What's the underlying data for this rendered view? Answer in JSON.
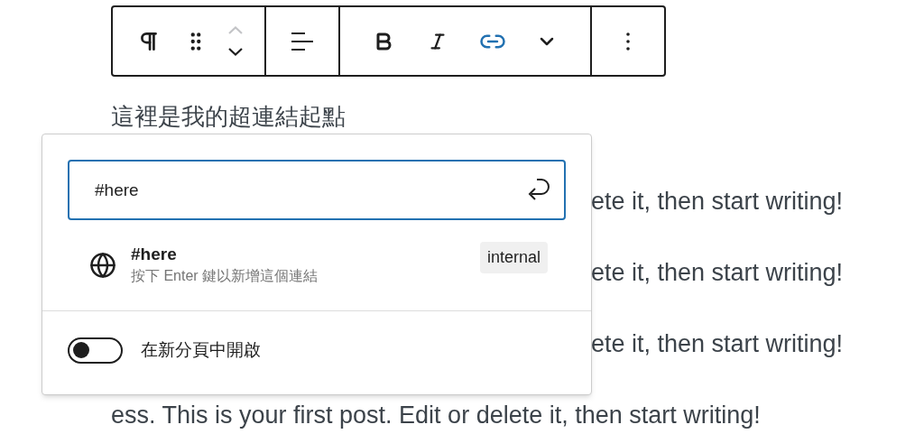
{
  "toolbar": {
    "groups": [
      {
        "buttons": [
          {
            "kind": "paragraph",
            "active": false,
            "disabled": false
          },
          {
            "kind": "drag",
            "active": false,
            "disabled": false
          },
          {
            "kind": "move",
            "up_disabled": true,
            "down_disabled": false
          }
        ]
      },
      {
        "buttons": [
          {
            "kind": "align",
            "active": false,
            "disabled": false
          }
        ]
      },
      {
        "buttons": [
          {
            "kind": "bold",
            "active": false,
            "disabled": false
          },
          {
            "kind": "italic",
            "active": false,
            "disabled": false
          },
          {
            "kind": "link",
            "active": true,
            "disabled": false
          },
          {
            "kind": "more",
            "active": false,
            "disabled": false
          }
        ]
      },
      {
        "buttons": [
          {
            "kind": "options",
            "active": false,
            "disabled": false
          }
        ]
      }
    ]
  },
  "heading_paragraph": "這裡是我的超連結起點",
  "body_lines": [
    {
      "text": "ete it, then start writing!",
      "covered": true
    },
    {
      "text": "ete it, then start writing!",
      "covered": true
    },
    {
      "text": "ete it, then start writing!",
      "covered": true
    },
    {
      "text": "ess. This is your first post. Edit or delete it, then start writing!",
      "covered": false
    }
  ],
  "link_popover": {
    "url_field": {
      "value": "#here"
    },
    "suggestion": {
      "title": "#here",
      "hint": "按下 Enter 鍵以新增這個連結",
      "badge": "internal"
    },
    "new_tab_toggle": {
      "label": "在新分頁中開啟",
      "on": false
    }
  }
}
